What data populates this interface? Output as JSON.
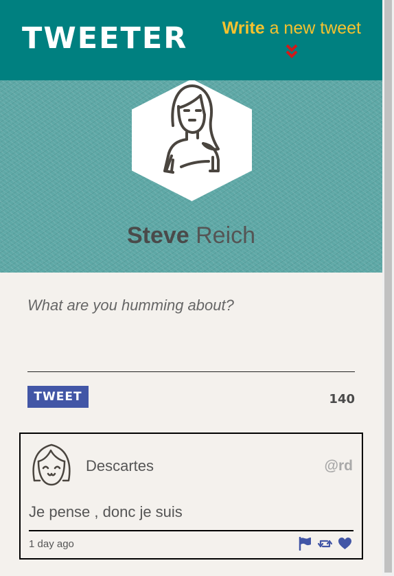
{
  "header": {
    "logo": "TWEETER",
    "compose_bold": "Write",
    "compose_rest": " a new tweet",
    "chevron_icon": "double-chevron-down-icon",
    "background_color": "#008080",
    "accent_color": "#f6c22e"
  },
  "profile": {
    "first_name": "Steve",
    "last_name": " Reich",
    "avatar_icon": "woman-avatar-icon"
  },
  "composer": {
    "placeholder": "What are you humming about?",
    "value": "",
    "button_label": "TWEET",
    "button_color": "#4256a6",
    "counter": "140"
  },
  "tweets": [
    {
      "author": "Descartes",
      "handle": "@rd",
      "text": "Je pense , donc je suis",
      "time": "1 day ago",
      "avatar_icon": "girl-avatar-icon",
      "actions": [
        "flag-icon",
        "retweet-icon",
        "heart-icon"
      ]
    }
  ]
}
